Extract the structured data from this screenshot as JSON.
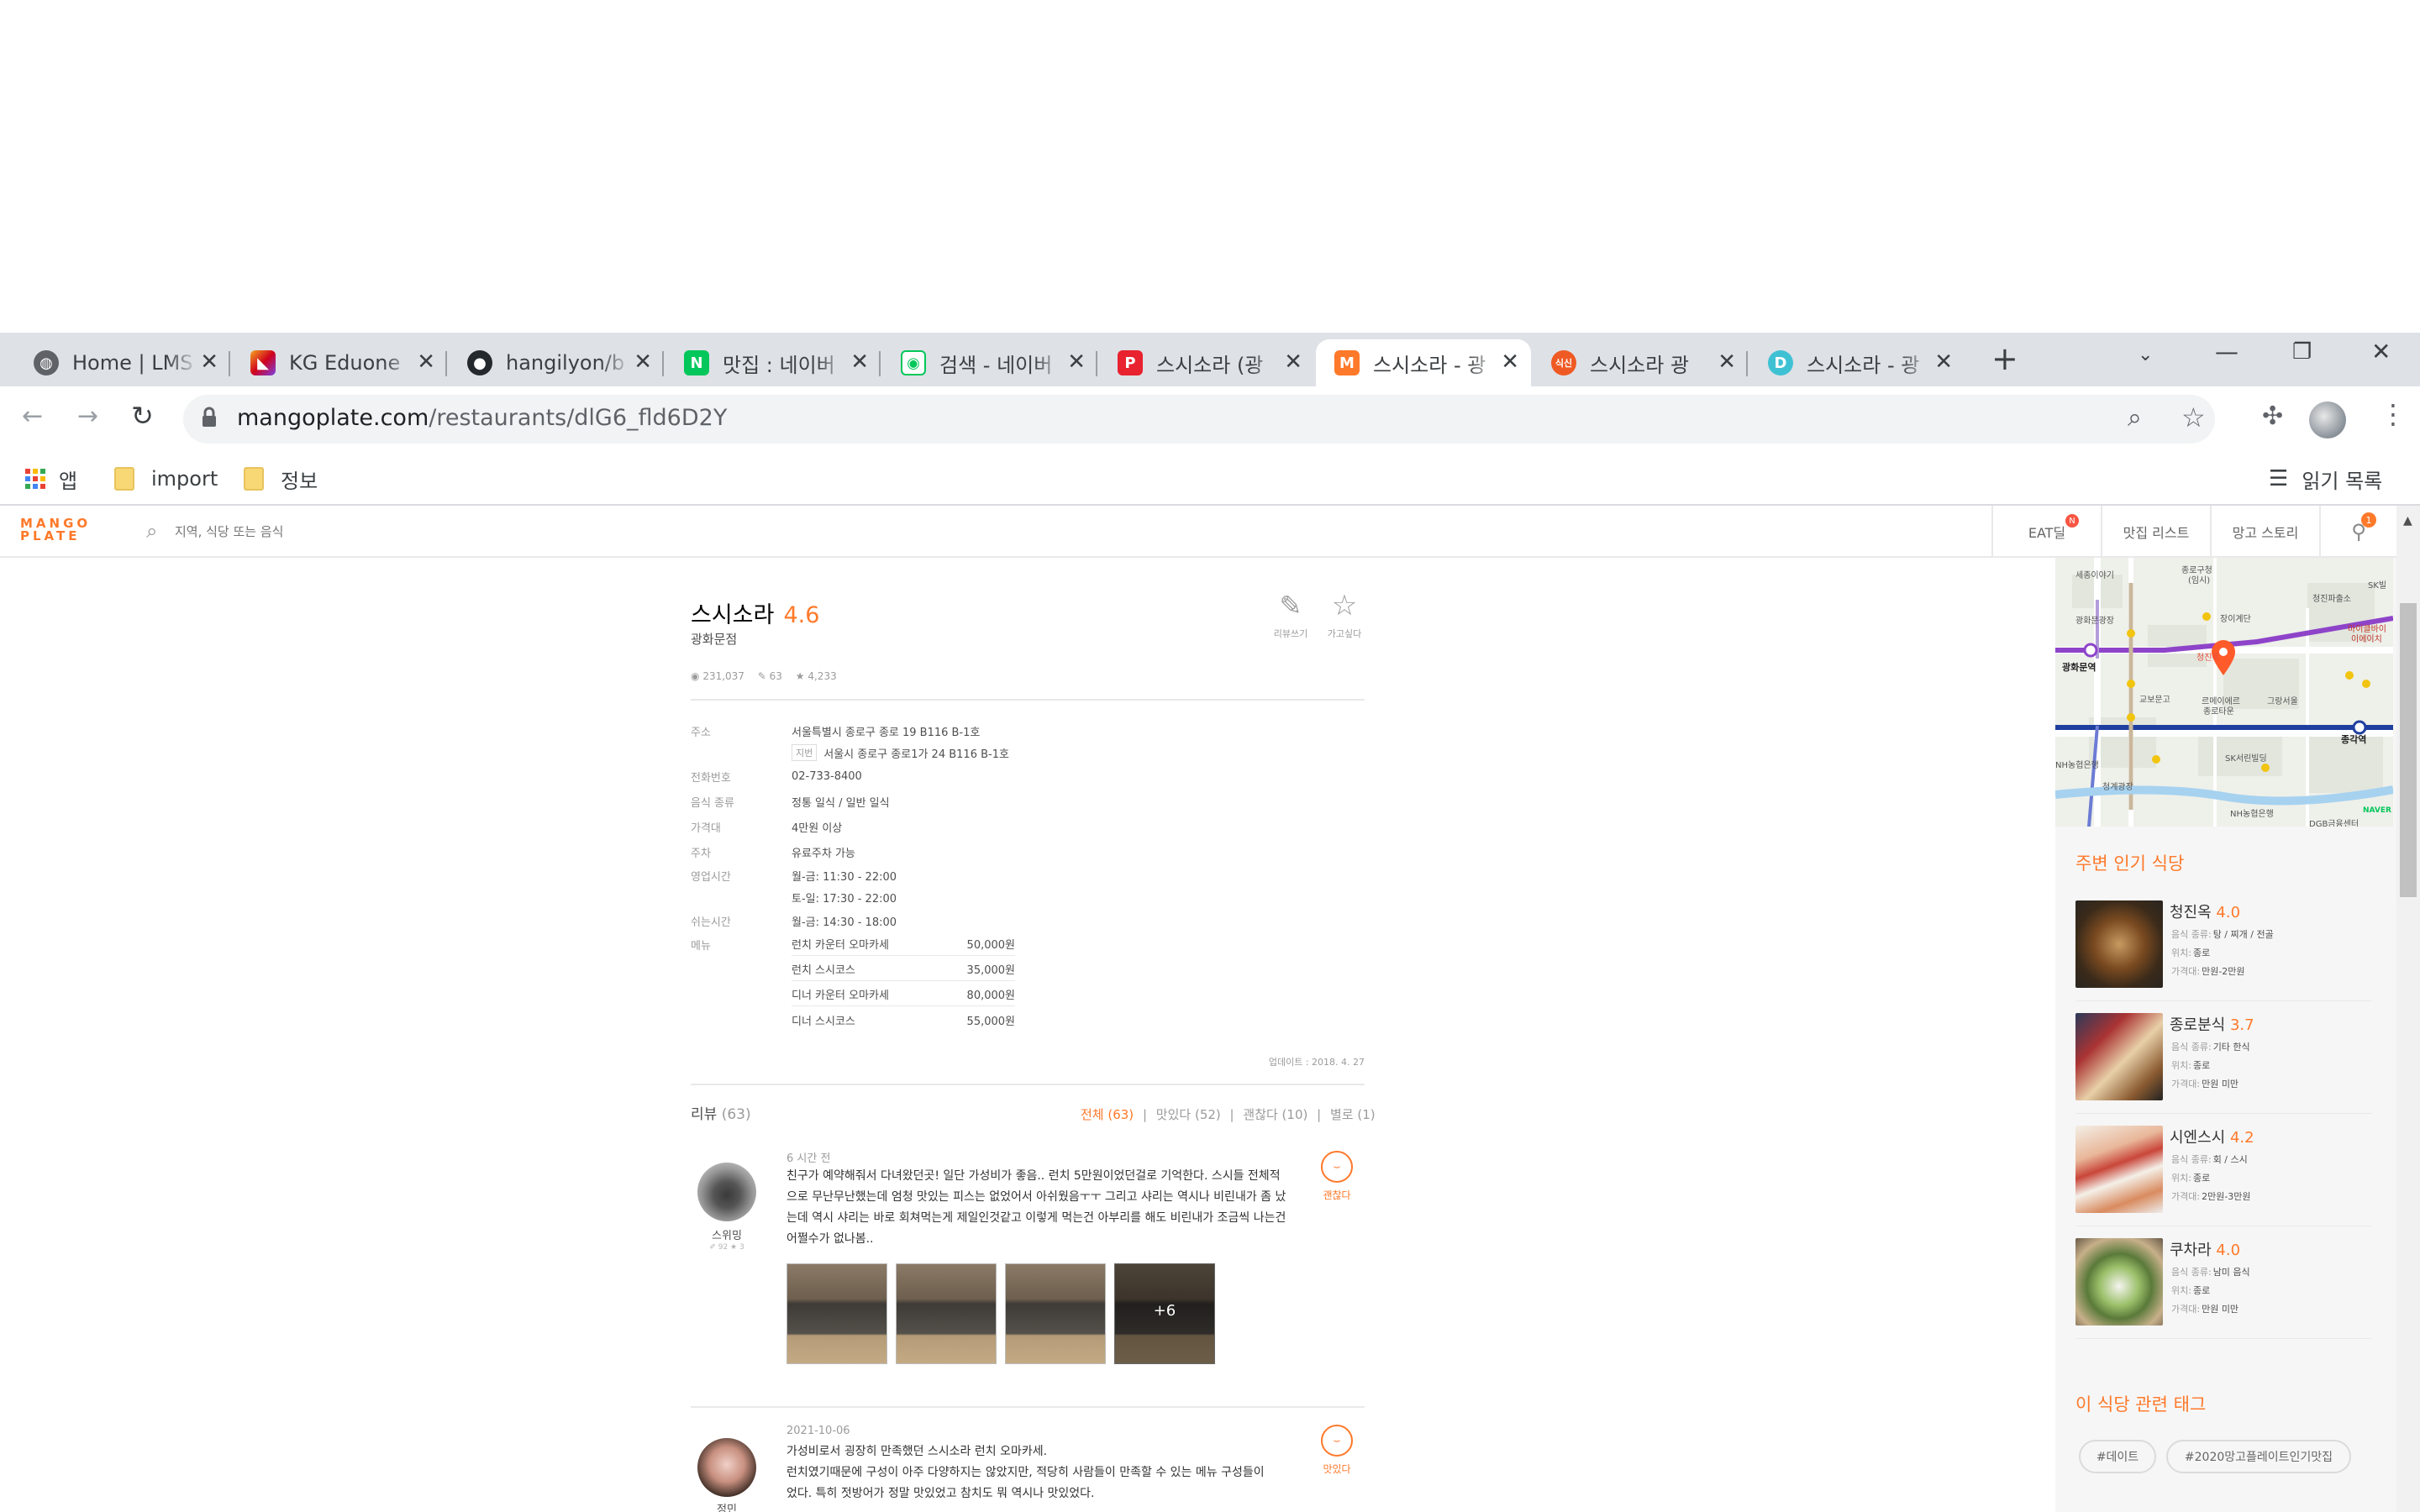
{
  "browser": {
    "tabs": [
      {
        "title": "Home | LMS",
        "fav": "globe-icon"
      },
      {
        "title": "KG Eduone",
        "fav": "kg-icon"
      },
      {
        "title": "hangilyon/b",
        "fav": "github-icon"
      },
      {
        "title": "맛집 : 네이버",
        "fav": "naver-icon"
      },
      {
        "title": "검색 - 네이버",
        "fav": "naver-map-icon"
      },
      {
        "title": "스시소라 (광",
        "fav": "p-icon"
      },
      {
        "title": "스시소라 - 광",
        "fav": "mango-icon"
      },
      {
        "title": "스시소라 광",
        "fav": "siksin-icon"
      },
      {
        "title": "스시소라 - 광",
        "fav": "d-icon"
      }
    ],
    "url_host": "mangoplate.com",
    "url_path": "/restaurants/dlG6_fld6D2Y",
    "bookmarks": {
      "apps": "앱",
      "folder1": "import",
      "folder2": "정보",
      "reading_list": "읽기 목록"
    }
  },
  "header": {
    "logo_top": "MANGO",
    "logo_bottom": "PLATE",
    "search_placeholder": "지역, 식당 또는 음식",
    "nav": {
      "eatdeal": "EAT딜",
      "eatdeal_badge": "N",
      "list": "맛집 리스트",
      "story": "망고 스토리",
      "profile_badge": "1"
    }
  },
  "restaurant": {
    "name": "스시소라",
    "rating": "4.6",
    "branch": "광화문점",
    "views": "231,037",
    "reviews": "63",
    "wants": "4,233",
    "write_review": "리뷰쓰기",
    "want_to_go": "가고싶다",
    "info": {
      "address_label": "주소",
      "address": "서울특별시 종로구 종로 19 B116 B-1호",
      "jibun_label": "지번",
      "jibun": "서울시 종로구 종로1가 24 B116 B-1호",
      "phone_label": "전화번호",
      "phone": "02-733-8400",
      "food_label": "음식 종류",
      "food": "정통 일식 / 일반 일식",
      "price_label": "가격대",
      "price": "4만원 이상",
      "parking_label": "주차",
      "parking": "유료주차 가능",
      "hours_label": "영업시간",
      "hours1": "월-금: 11:30 - 22:00",
      "hours2": "토-일: 17:30 - 22:00",
      "break_label": "쉬는시간",
      "break": "월-금: 14:30 - 18:00",
      "menu_label": "메뉴",
      "menu": [
        {
          "name": "런치 카운터 오마카세",
          "price": "50,000원"
        },
        {
          "name": "런치 스시코스",
          "price": "35,000원"
        },
        {
          "name": "디너 카운터 오마카세",
          "price": "80,000원"
        },
        {
          "name": "디너 스시코스",
          "price": "55,000원"
        }
      ],
      "updated": "업데이트 : 2018. 4. 27"
    }
  },
  "reviews": {
    "title": "리뷰",
    "count": "(63)",
    "filters": {
      "all": "전체 (63)",
      "good": "맛있다 (52)",
      "ok": "괜찮다 (10)",
      "bad": "별로 (1)"
    },
    "items": [
      {
        "user": "스위밍",
        "user_meta": "✐ 92  ★ 3",
        "time": "6 시간 전",
        "text": "친구가 예약해줘서 다녀왔던곳! 일단 가성비가 좋음.. 런치 5만원이었던걸로 기억한다. 스시들 전체적으로 무난무난했는데 엄청 맛있는 피스는 없었어서 아쉬웠음ㅜㅜ 그리고 샤리는 역시나 비린내가 좀 났는데 역시 샤리는 바로 회쳐먹는게 제일인것같고 이렇게 먹는건 아부리를 해도 비린내가 조금씩 나는건 어쩔수가 없나봄..",
        "rating": "괜찮다",
        "more_photos": "+6"
      },
      {
        "user": "정민",
        "time": "2021-10-06",
        "line1": "가성비로서 굉장히 만족했던 스시소라 런치 오마카세.",
        "line2": "런치였기때문에 구성이 아주 다양하지는 않았지만, 적당히 사람들이 만족할 수 있는 메뉴 구성들이",
        "line3": "었다. 특히 젓방어가 정말 맛있었고 참치도 뭐 역시나 맛있었다.",
        "rating": "맛있다"
      }
    ]
  },
  "sidebar": {
    "map": {
      "labels": [
        "세종이야기",
        "종로구청",
        "(임시)",
        "광화문광장",
        "광화문역",
        "교보문고",
        "장이계단",
        "청진옥",
        "르메이에르",
        "종로타운",
        "그랑서울",
        "종각역",
        "SK서린빌딩",
        "NH농협은행",
        "청계광장",
        "NH농협은행",
        "SK빌",
        "마이클바이",
        "이에이치",
        "청진파출소",
        "DGB금융센터",
        "NAVER"
      ]
    },
    "nearby_title": "주변 인기 식당",
    "nearby": [
      {
        "name": "청진옥",
        "rating": "4.0",
        "food_k": "음식 종류:",
        "food": "탕 / 찌개 / 전골",
        "loc_k": "위치:",
        "loc": "종로",
        "price_k": "가격대:",
        "price": "만원-2만원"
      },
      {
        "name": "종로분식",
        "rating": "3.7",
        "food_k": "음식 종류:",
        "food": "기타 한식",
        "loc_k": "위치:",
        "loc": "종로",
        "price_k": "가격대:",
        "price": "만원 미만"
      },
      {
        "name": "시엔스시",
        "rating": "4.2",
        "food_k": "음식 종류:",
        "food": "회 / 스시",
        "loc_k": "위치:",
        "loc": "종로",
        "price_k": "가격대:",
        "price": "2만원-3만원"
      },
      {
        "name": "쿠차라",
        "rating": "4.0",
        "food_k": "음식 종류:",
        "food": "남미 음식",
        "loc_k": "위치:",
        "loc": "종로",
        "price_k": "가격대:",
        "price": "만원 미만"
      }
    ],
    "tags_title": "이 식당 관련 태그",
    "tags": [
      "#데이트",
      "#2020망고플레이트인기맛집"
    ]
  },
  "colors": {
    "accent": "#ff792a",
    "tabbar": "#dee1e6",
    "text": "#333333"
  }
}
